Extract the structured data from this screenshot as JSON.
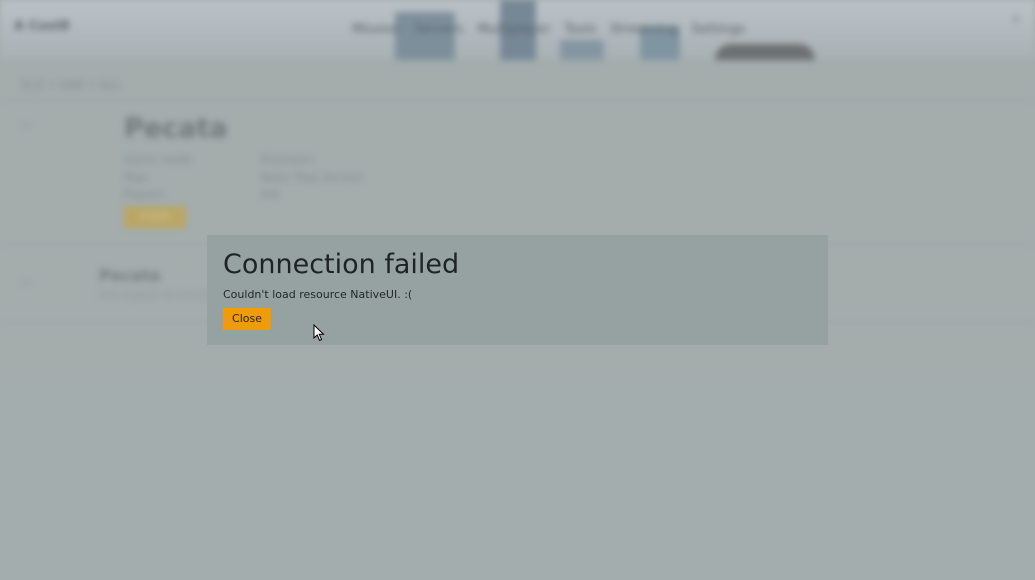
{
  "background_app": {
    "logo": "A Cool8",
    "nav_items": [
      "Mission",
      "Servers",
      "Multiplayer",
      "Tools",
      "Streaming",
      "Settings"
    ],
    "close_glyph": "×",
    "breadcrumb": "ELS • UNK • ALL",
    "resource": {
      "title": "Pecata",
      "rows": [
        {
          "label": "Game mode",
          "value": "Freeroam"
        },
        {
          "label": "Map",
          "value": "Baltic Map Version"
        },
        {
          "label": "Players",
          "value": "4/4"
        }
      ],
      "install_label": "Install"
    },
    "sub_resource": {
      "title": "Pecata",
      "description": "info tagged: Id Concept Pack 5"
    }
  },
  "dialog": {
    "title": "Connection failed",
    "message": "Couldn't load resource NativeUI. :(",
    "close_label": "Close",
    "accent_color": "#f09c0a",
    "background_color": "#96a2a1"
  },
  "icons": {
    "cursor": "arrow-cursor-icon"
  }
}
